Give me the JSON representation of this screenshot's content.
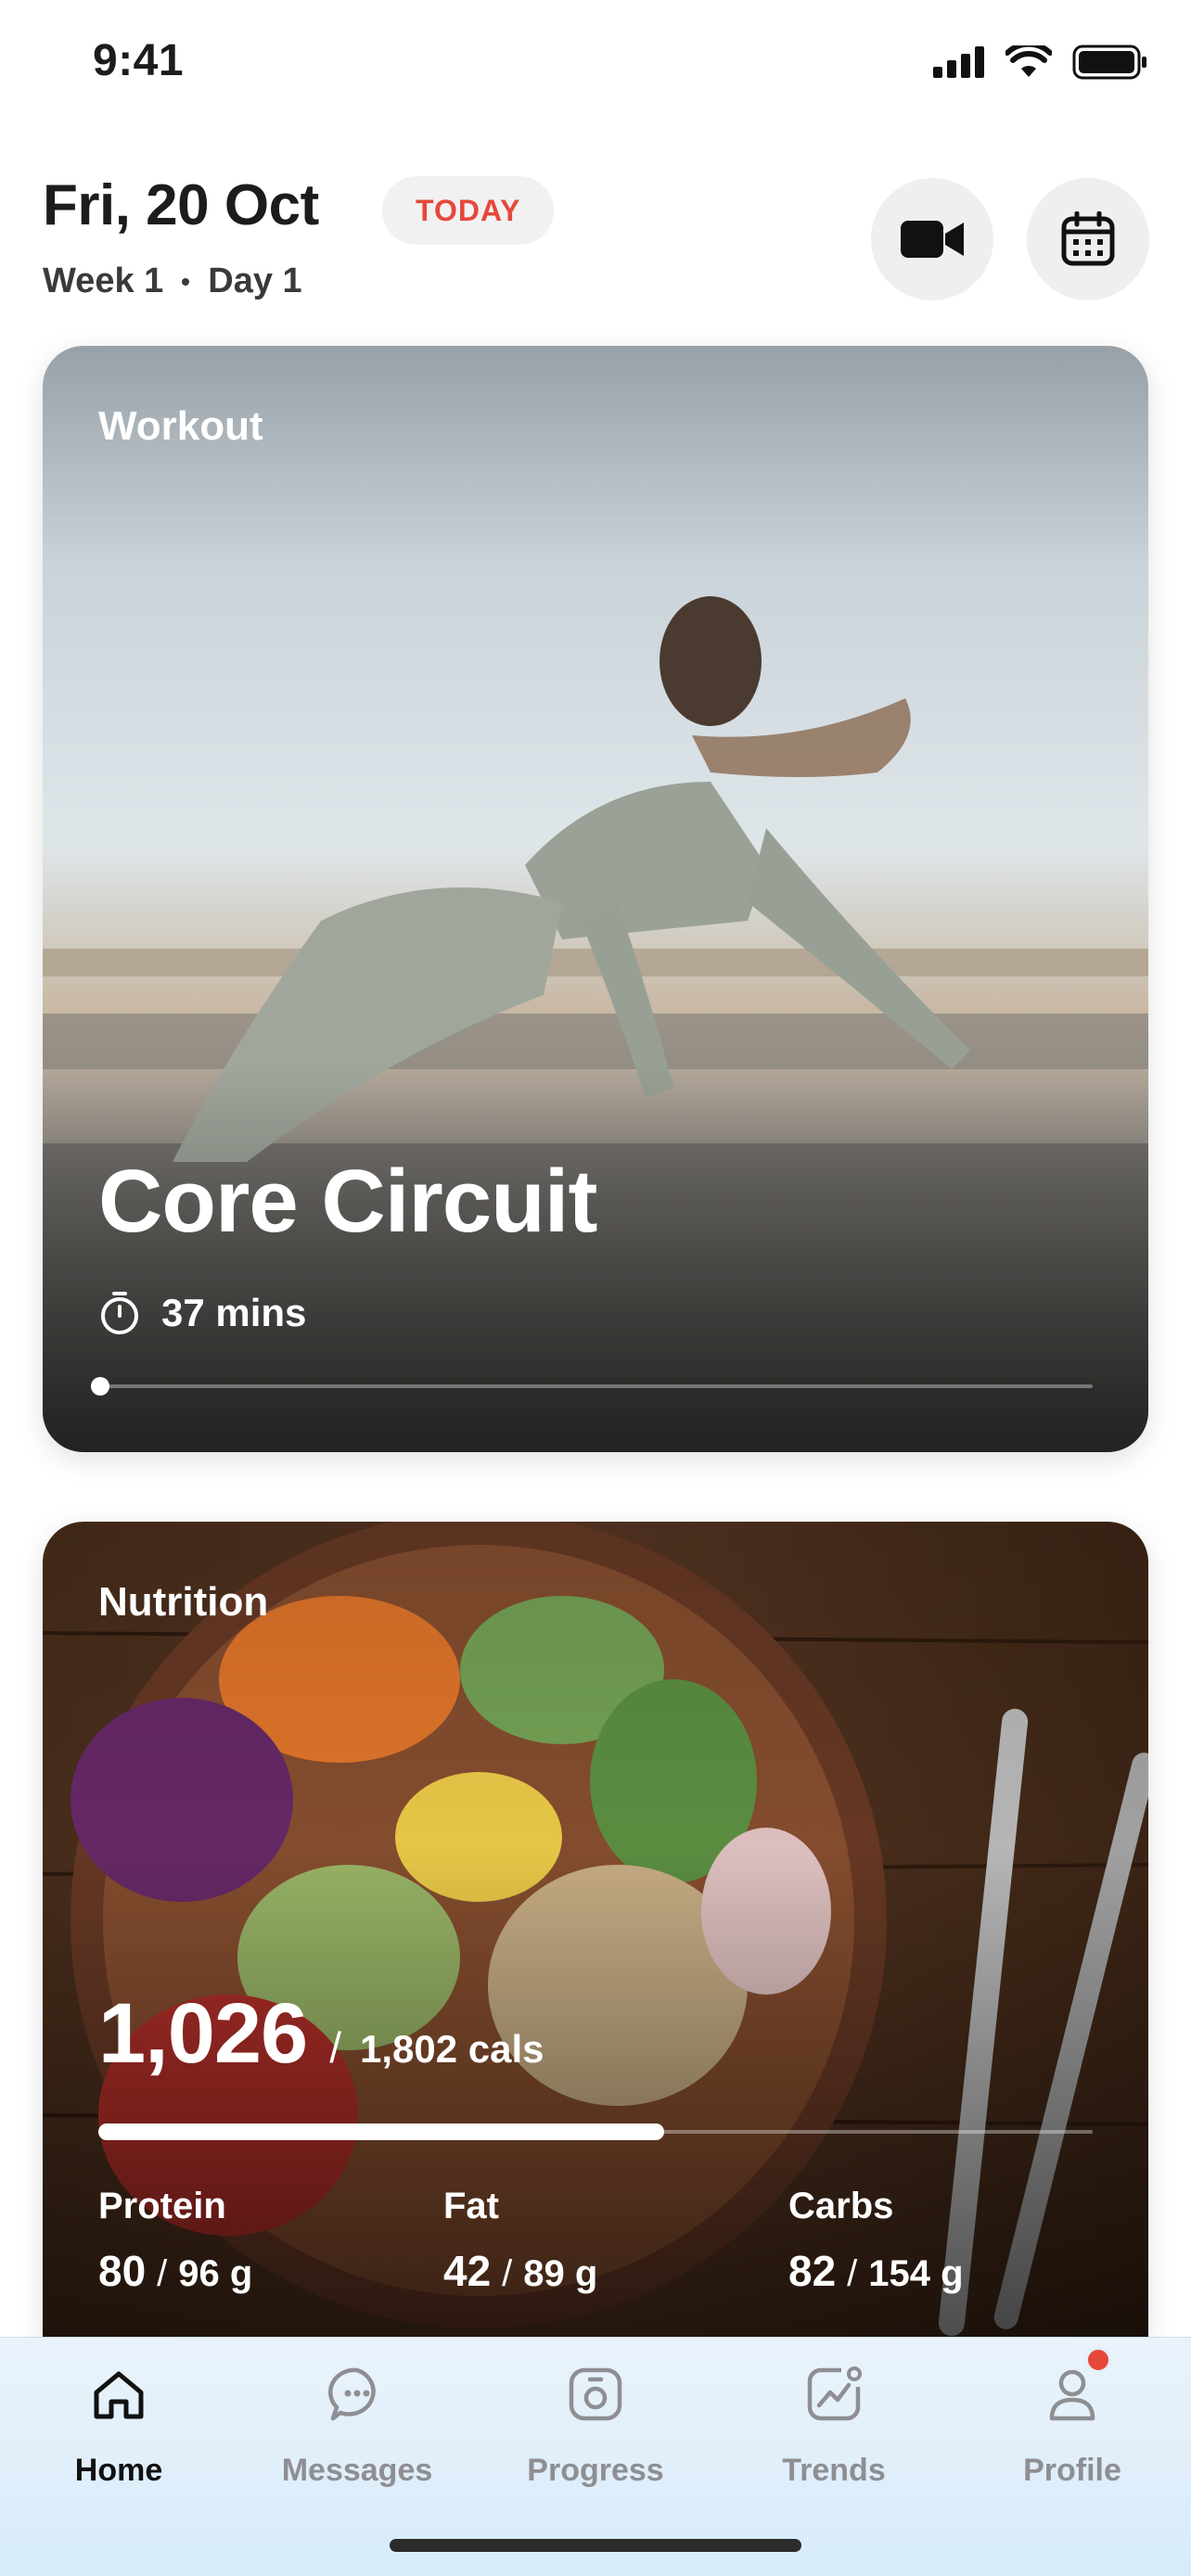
{
  "status_bar": {
    "time": "9:41"
  },
  "header": {
    "date": "Fri, 20 Oct",
    "today_badge": "TODAY",
    "week": "Week 1",
    "day": "Day 1"
  },
  "workout": {
    "label": "Workout",
    "title": "Core Circuit",
    "duration": "37 mins",
    "progress": 0
  },
  "nutrition": {
    "label": "Nutrition",
    "calories_eaten": "1,026",
    "calories_target": "1,802 cals",
    "calorie_progress": 0.569,
    "macros": [
      {
        "name": "Protein",
        "value": "80",
        "target": "96 g"
      },
      {
        "name": "Fat",
        "value": "42",
        "target": "89 g"
      },
      {
        "name": "Carbs",
        "value": "82",
        "target": "154 g"
      }
    ]
  },
  "tabs": [
    {
      "label": "Home",
      "icon": "home-icon",
      "active": true
    },
    {
      "label": "Messages",
      "icon": "messages-icon",
      "active": false
    },
    {
      "label": "Progress",
      "icon": "progress-icon",
      "active": false
    },
    {
      "label": "Trends",
      "icon": "trends-icon",
      "active": false
    },
    {
      "label": "Profile",
      "icon": "profile-icon",
      "active": false
    }
  ],
  "colors": {
    "accent_red": "#e5483b",
    "tab_active": "#111111",
    "tab_inactive": "#8e8e93"
  }
}
